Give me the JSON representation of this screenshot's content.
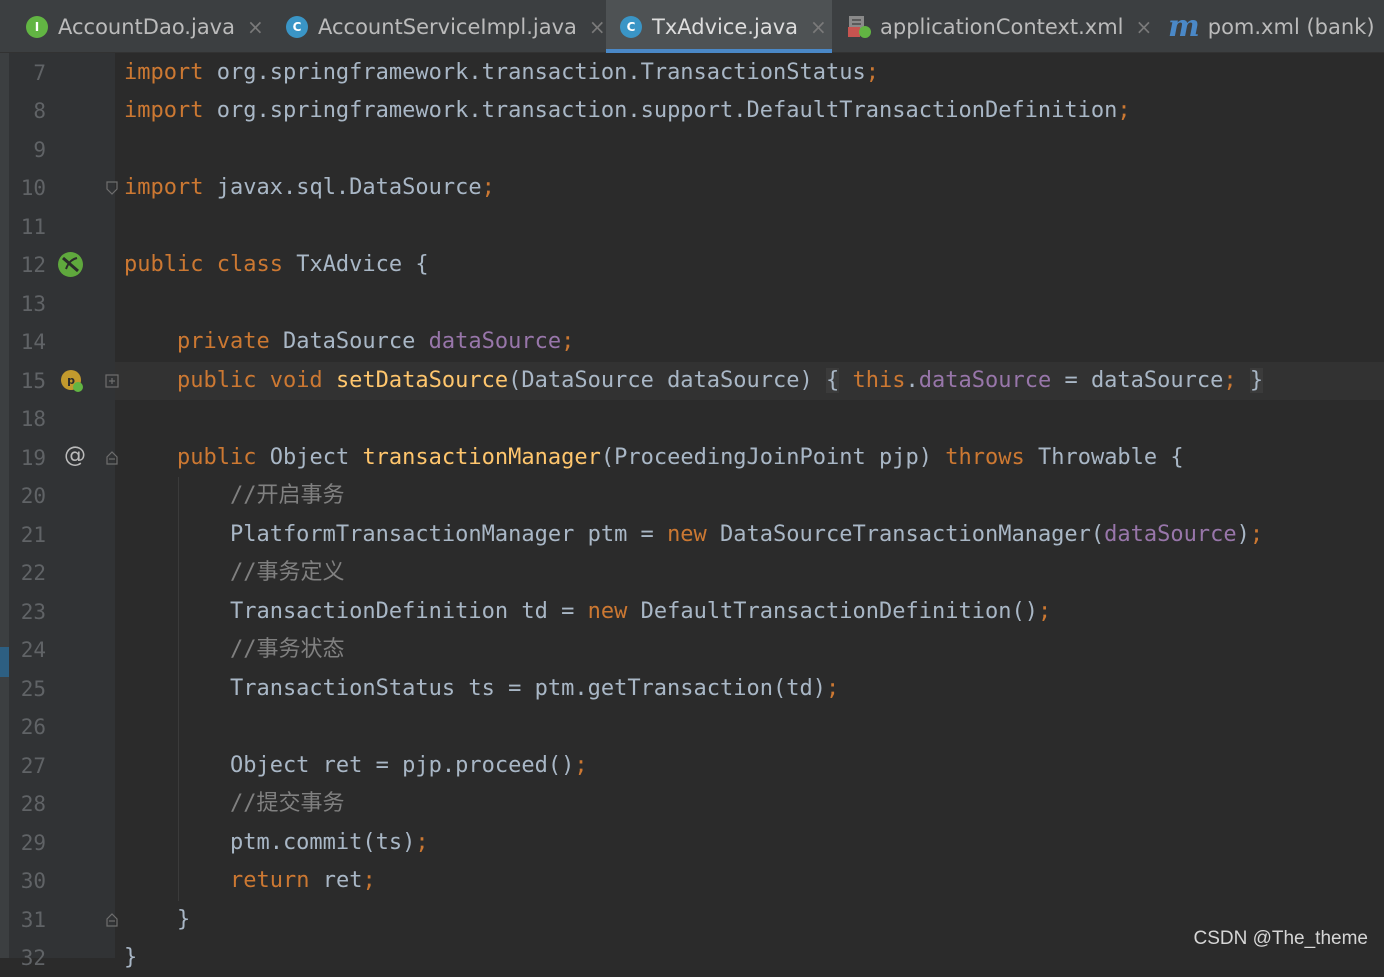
{
  "tabs": [
    {
      "label": "AccountDao.java",
      "icon": "interface-icon",
      "icon_letter": "I",
      "active": false
    },
    {
      "label": "AccountServiceImpl.java",
      "icon": "class-icon",
      "icon_letter": "C",
      "active": false
    },
    {
      "label": "TxAdvice.java",
      "icon": "class-icon",
      "icon_letter": "C",
      "active": true
    },
    {
      "label": "applicationContext.xml",
      "icon": "xml-file-icon",
      "active": false
    },
    {
      "label": "pom.xml (bank)",
      "icon": "maven-icon",
      "icon_letter": "m",
      "active": false
    }
  ],
  "close_glyph": "×",
  "colors": {
    "keyword": "#cc7832",
    "field": "#9876aa",
    "method": "#ffc66d",
    "comment": "#808080",
    "text": "#a9b7c6",
    "accent": "#4a88c7"
  },
  "editor": {
    "lines": [
      {
        "n": "7",
        "text": "import org.springframework.transaction.TransactionStatus;"
      },
      {
        "n": "8",
        "text": "import org.springframework.transaction.support.DefaultTransactionDefinition;"
      },
      {
        "n": "9",
        "text": ""
      },
      {
        "n": "10",
        "text": "import javax.sql.DataSource;"
      },
      {
        "n": "11",
        "text": ""
      },
      {
        "n": "12",
        "text": "public class TxAdvice {"
      },
      {
        "n": "13",
        "text": ""
      },
      {
        "n": "14",
        "text": "private DataSource dataSource;"
      },
      {
        "n": "15",
        "text": "public void setDataSource(DataSource dataSource) { this.dataSource = dataSource; }"
      },
      {
        "n": "18",
        "text": ""
      },
      {
        "n": "19",
        "text": "public Object transactionManager(ProceedingJoinPoint pjp) throws Throwable {"
      },
      {
        "n": "20",
        "text": "//开启事务"
      },
      {
        "n": "21",
        "text": "PlatformTransactionManager ptm = new DataSourceTransactionManager(dataSource);"
      },
      {
        "n": "22",
        "text": "//事务定义"
      },
      {
        "n": "23",
        "text": "TransactionDefinition td = new DefaultTransactionDefinition();"
      },
      {
        "n": "24",
        "text": "//事务状态"
      },
      {
        "n": "25",
        "text": "TransactionStatus ts = ptm.getTransaction(td);"
      },
      {
        "n": "26",
        "text": ""
      },
      {
        "n": "27",
        "text": "Object ret = pjp.proceed();"
      },
      {
        "n": "28",
        "text": "//提交事务"
      },
      {
        "n": "29",
        "text": "ptm.commit(ts);"
      },
      {
        "n": "30",
        "text": "return ret;"
      },
      {
        "n": "31",
        "text": "}"
      },
      {
        "n": "32",
        "text": "}"
      }
    ],
    "gutter_marks": {
      "12": "spring-bean-icon",
      "15": "property-setter-icon",
      "19": "override-annotation-icon"
    },
    "at_glyph": "@"
  },
  "watermark": "CSDN @The_theme"
}
